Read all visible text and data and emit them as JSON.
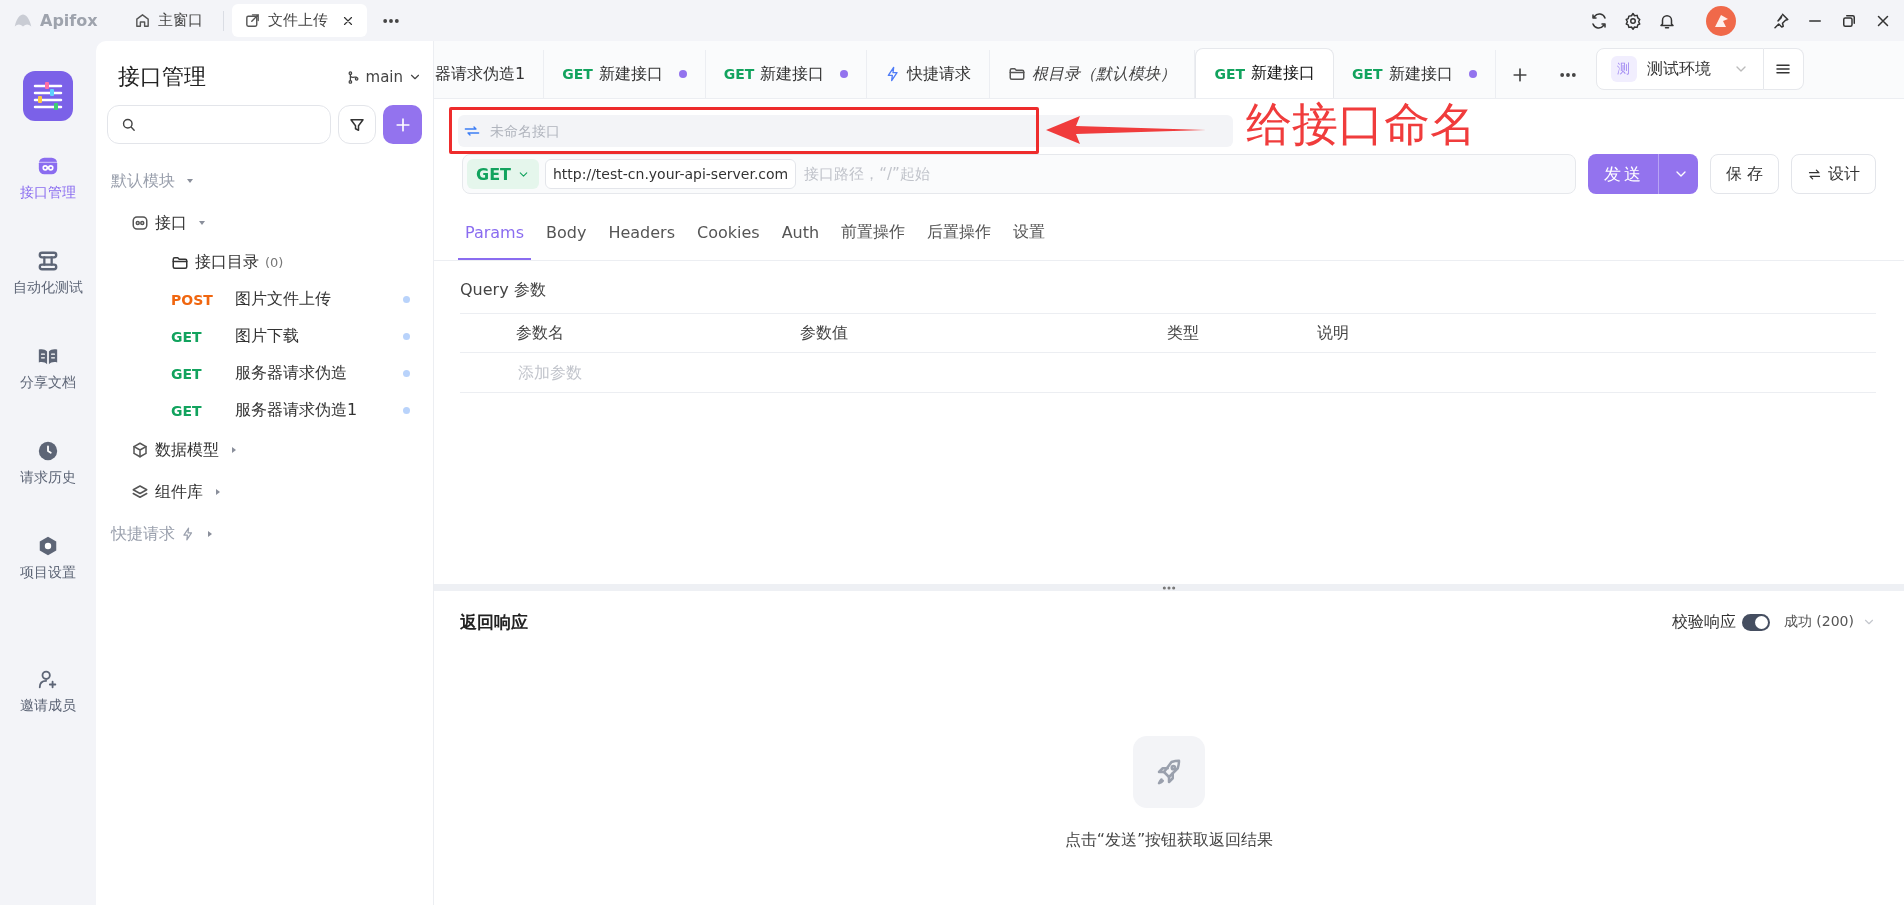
{
  "app": {
    "name": "Apifox"
  },
  "window_tabs": [
    {
      "kind": "home",
      "label": "主窗口",
      "selected": false,
      "closable": false
    },
    {
      "kind": "popout",
      "label": "文件上传",
      "selected": true,
      "closable": true
    }
  ],
  "nav": [
    {
      "kind": "api",
      "label": "接口管理",
      "selected": true
    },
    {
      "kind": "test",
      "label": "自动化测试",
      "selected": false
    },
    {
      "kind": "doc",
      "label": "分享文档",
      "selected": false
    },
    {
      "kind": "history",
      "label": "请求历史",
      "selected": false
    },
    {
      "kind": "settings",
      "label": "项目设置",
      "selected": false
    },
    {
      "kind": "invite",
      "label": "邀请成员",
      "selected": false
    }
  ],
  "sidebar": {
    "title": "接口管理",
    "branch": "main",
    "tree": [
      {
        "kind": "module",
        "label": "默认模块",
        "expanded": true,
        "children": [
          {
            "kind": "endpoints",
            "label": "接口",
            "expanded": true,
            "children": [
              {
                "kind": "folder",
                "label": "接口目录",
                "count": "(0)"
              },
              {
                "kind": "request",
                "method": "POST",
                "label": "图片文件上传"
              },
              {
                "kind": "request",
                "method": "GET",
                "label": "图片下载"
              },
              {
                "kind": "request",
                "method": "GET",
                "label": "服务器请求伪造"
              },
              {
                "kind": "request",
                "method": "GET",
                "label": "服务器请求伪造1"
              }
            ]
          },
          {
            "kind": "models",
            "label": "数据模型",
            "expanded": false
          },
          {
            "kind": "components",
            "label": "组件库",
            "expanded": false
          }
        ]
      },
      {
        "kind": "quick",
        "label": "快捷请求",
        "expanded": false
      }
    ]
  },
  "request_tabs": [
    {
      "kind": "api",
      "label": "器请求伪造1",
      "selected": false,
      "modified": false
    },
    {
      "kind": "api",
      "method": "GET",
      "label": "新建接口",
      "selected": false,
      "modified": true
    },
    {
      "kind": "api",
      "method": "GET",
      "label": "新建接口",
      "selected": false,
      "modified": true
    },
    {
      "kind": "quick",
      "label": "快捷请求",
      "selected": false,
      "modified": false
    },
    {
      "kind": "folder",
      "label": "根目录（默认模块）",
      "selected": false,
      "modified": false
    },
    {
      "kind": "api",
      "method": "GET",
      "label": "新建接口",
      "selected": true,
      "modified": false
    },
    {
      "kind": "api",
      "method": "GET",
      "label": "新建接口",
      "selected": false,
      "modified": true
    }
  ],
  "environment": {
    "badge": "测",
    "label": "测试环境"
  },
  "request": {
    "name": {
      "placeholder": "未命名接口"
    },
    "method": "GET",
    "base_url": "http://test-cn.your-api-server.com",
    "path": {
      "placeholder": "接口路径，“/”起始"
    },
    "send": "发送",
    "save": "保 存",
    "design": "设计"
  },
  "param_tabs": [
    {
      "label": "Params",
      "selected": true
    },
    {
      "label": "Body",
      "selected": false
    },
    {
      "label": "Headers",
      "selected": false
    },
    {
      "label": "Cookies",
      "selected": false
    },
    {
      "label": "Auth",
      "selected": false
    },
    {
      "label": "前置操作",
      "selected": false
    },
    {
      "label": "后置操作",
      "selected": false
    },
    {
      "label": "设置",
      "selected": false
    }
  ],
  "query": {
    "title": "Query 参数",
    "columns": [
      "参数名",
      "参数值",
      "类型",
      "说明"
    ],
    "add": {
      "placeholder": "添加参数"
    }
  },
  "response": {
    "title": "返回响应",
    "validate": {
      "label": "校验响应",
      "on": true
    },
    "status": "成功 (200)",
    "empty_text": "点击“发送”按钮获取返回结果"
  },
  "annotation": {
    "label": "给接口命名"
  }
}
